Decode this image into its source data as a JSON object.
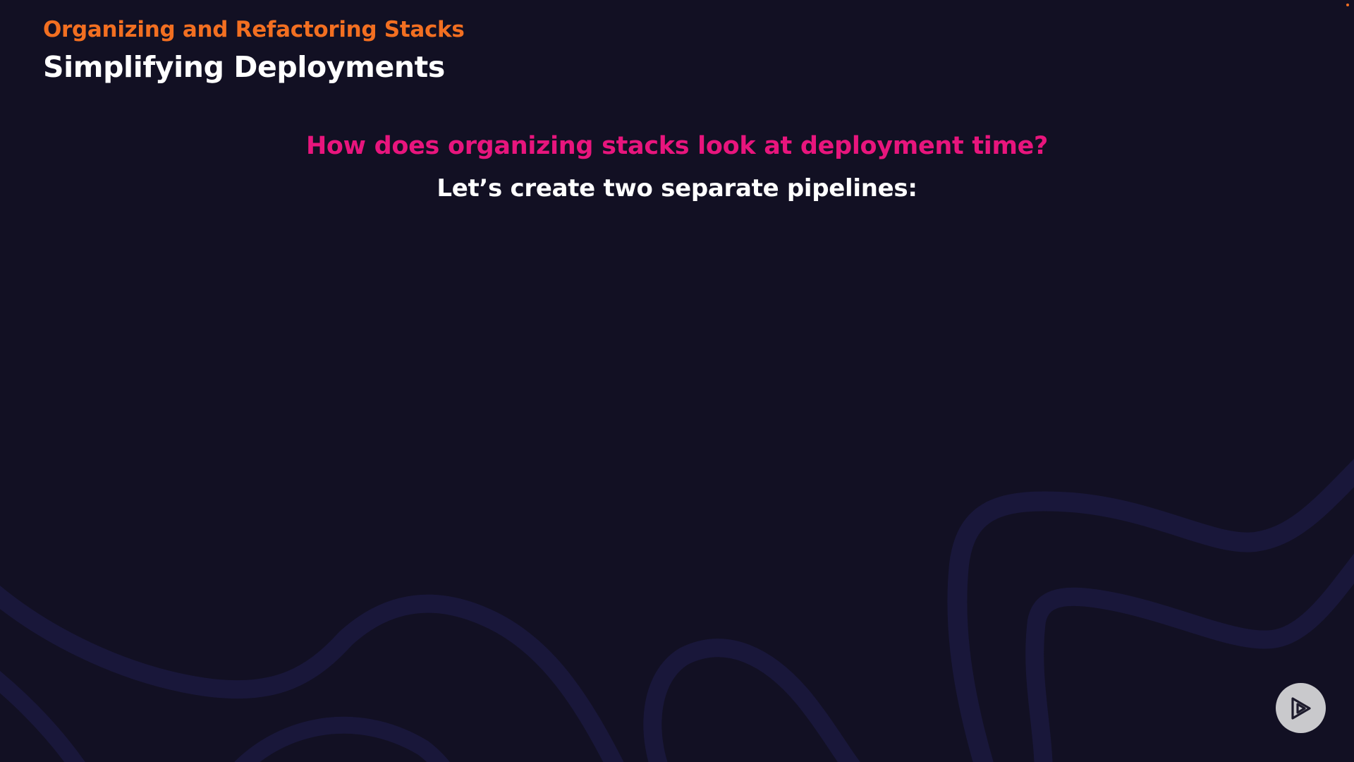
{
  "slide": {
    "section_title": "Organizing and Refactoring Stacks",
    "title": "Simplifying Deployments",
    "question": "How does organizing stacks look at deployment time?",
    "statement": "Let’s create two separate pipelines:"
  },
  "icons": {
    "background": "decorative-swirl-lines",
    "player": "play-logo-icon",
    "corner": "corner-dot"
  },
  "colors": {
    "background": "#121023",
    "section_title": "#f26f21",
    "title": "#ffffff",
    "question": "#e8157d",
    "statement": "#ffffff",
    "swirl": "#19173a",
    "play_button_bg": "#c9c9cc",
    "play_icon": "#1d1b2c",
    "corner_dot": "#f26f21"
  }
}
